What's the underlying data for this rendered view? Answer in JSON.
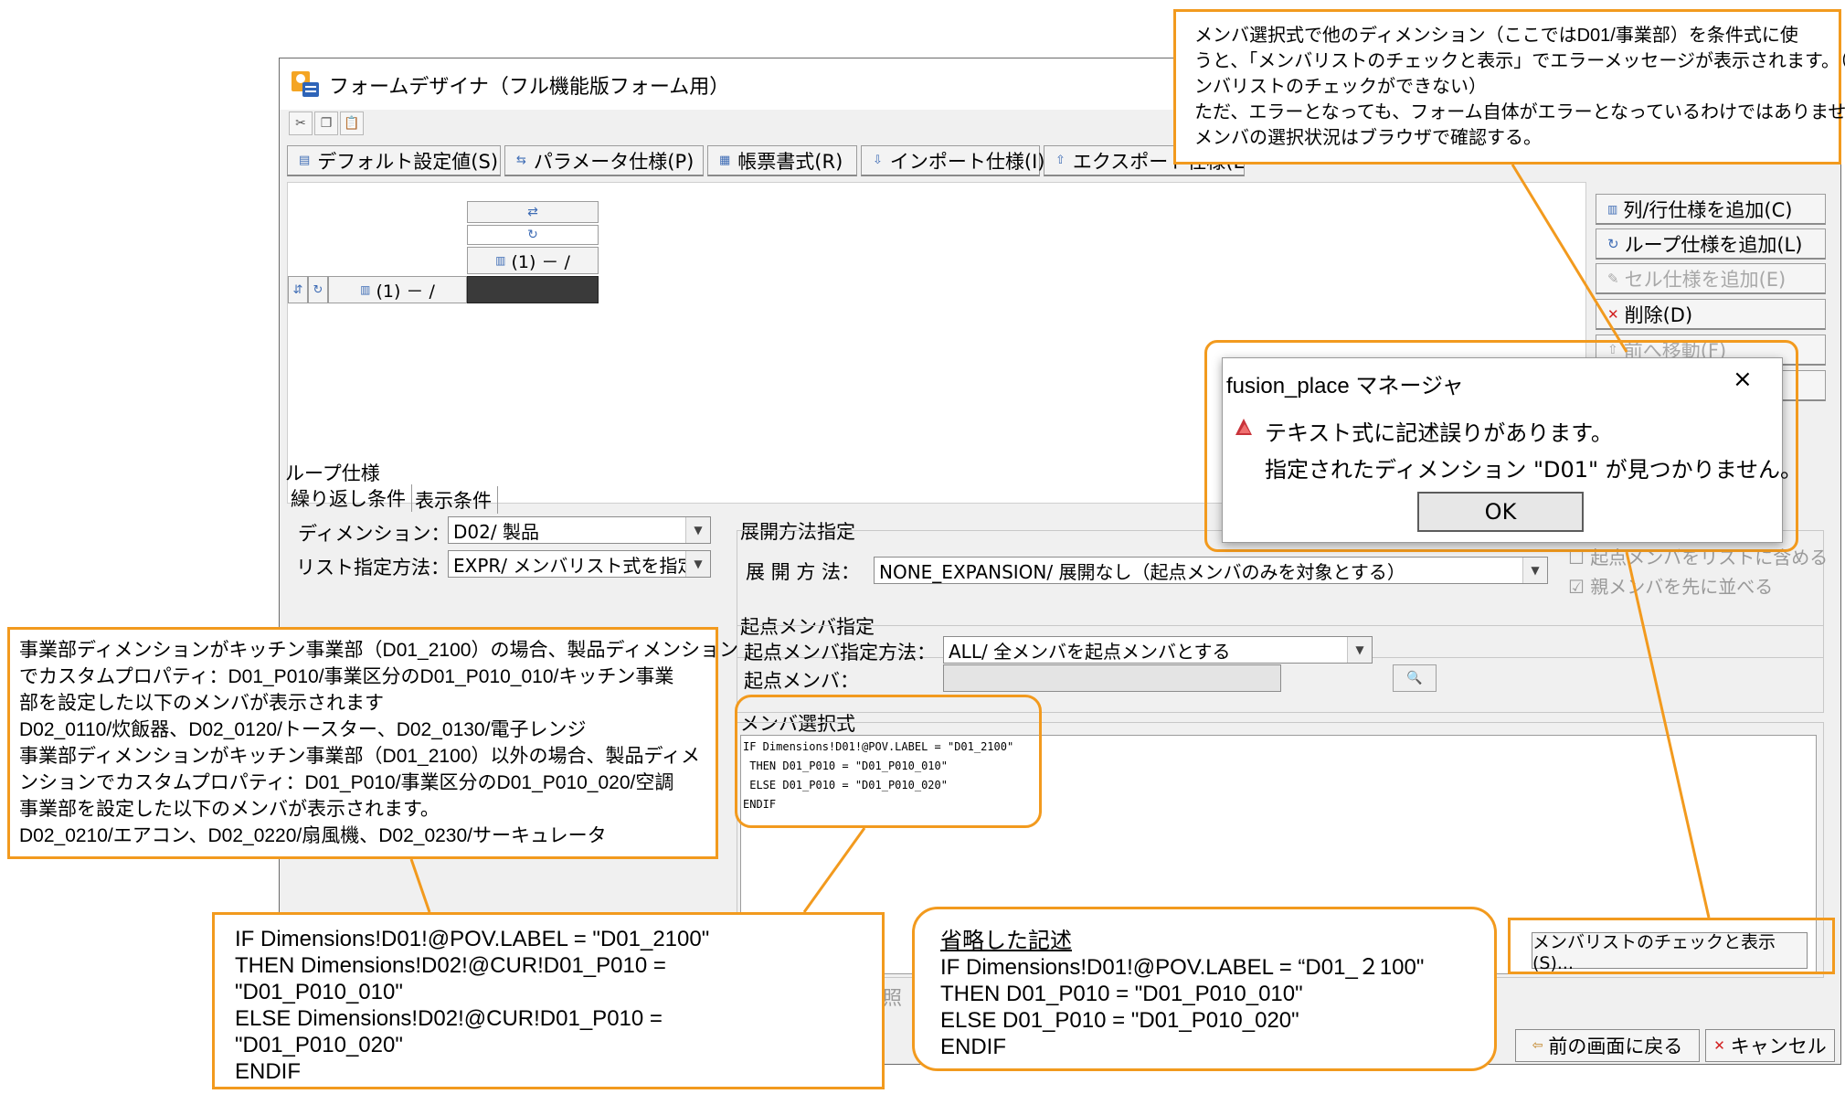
{
  "window": {
    "title": "フォームデザイナ（フル機能版フォーム用）",
    "toolbar_icons": [
      "scissors-icon",
      "copy-icon",
      "paste-icon"
    ],
    "tabs": [
      {
        "label": "デフォルト設定値(S)",
        "icon": "default-icon"
      },
      {
        "label": "パラメータ仕様(P)",
        "icon": "parameter-icon"
      },
      {
        "label": "帳票書式(R)",
        "icon": "report-icon"
      },
      {
        "label": "インポート仕様(I)",
        "icon": "import-icon"
      },
      {
        "label": "エクスポート仕様(E)",
        "icon": "export-icon"
      }
    ],
    "grid": {
      "top_cell_label": "(1) － /",
      "row_cell_label": "(1) － /"
    },
    "side_buttons": [
      {
        "label": "列/行仕様を追加(C)",
        "icon": "grid-icon",
        "enabled": true
      },
      {
        "label": "ループ仕様を追加(L)",
        "icon": "loop-icon",
        "enabled": true
      },
      {
        "label": "セル仕様を追加(E)",
        "icon": "pencil-icon",
        "enabled": false
      },
      {
        "label": "削除(D)",
        "icon": "delete-x-icon",
        "enabled": true
      },
      {
        "label": "前へ移動(F)",
        "icon": "up-arrow-icon",
        "enabled": false
      }
    ],
    "loop_spec": {
      "section_title": "ループ仕様",
      "tabs": [
        "繰り返し条件",
        "表示条件"
      ],
      "dimension_label": "ディメンション：",
      "dimension_value": "D02/ 製品",
      "list_method_label": "リスト指定方法：",
      "list_method_value": "EXPR/ メンバリスト式を指定",
      "expansion_group": "展開方法指定",
      "expansion_label": "展 開 方 法：",
      "expansion_value": "NONE_EXPANSION/ 展開なし（起点メンバのみを対象とする）",
      "checkbox_include": "起点メンバをリストに含める",
      "checkbox_parent_first": "親メンバを先に並べる",
      "origin_group": "起点メンバ指定",
      "origin_method_label": "起点メンバ指定方法：",
      "origin_method_value": "ALL/ 全メンバを起点メンバとする",
      "origin_member_label": "起点メンバ：",
      "origin_member_value": "",
      "member_expr_label": "メンバ選択式",
      "member_expr_lines": [
        "IF Dimensions!D01!@POV.LABEL = \"D01_2100\"",
        " THEN D01_P010 = \"D01_P010_010\"",
        " ELSE D01_P010 = \"D01_P010_020\"",
        "ENDIF"
      ],
      "check_button": "メンバリストのチェックと表示(S)...",
      "partial_text": "照"
    },
    "bottom_buttons": {
      "back": "前の画面に戻る",
      "cancel": "キャンセル"
    }
  },
  "dialog": {
    "title": "fusion_place マネージャ",
    "close_glyph": "×",
    "message_line1": "テキスト式に記述誤りがあります。",
    "message_line2": "指定されたディメンション \"D01\" が見つかりません。",
    "ok": "OK"
  },
  "callouts": {
    "top_right": [
      "メンバ選択式で他のディメンション（ここではD01/事業部）を条件式に使",
      "うと、「メンバリストのチェックと表示」でエラーメッセージが表示されます。（メ",
      "ンバリストのチェックができない）",
      "ただ、エラーとなっても、フォーム自体がエラーとなっているわけではありません。",
      "メンバの選択状況はブラウザで確認する。"
    ],
    "left": [
      "事業部ディメンションがキッチン事業部（D01_2100）の場合、製品ディメンション",
      "でカスタムプロパティ：D01_P010/事業区分のD01_P010_010/キッチン事業",
      "部を設定した以下のメンバが表示されます",
      "D02_0110/炊飯器、D02_0120/トースター、D02_0130/電子レンジ",
      "事業部ディメンションがキッチン事業部（D01_2100）以外の場合、製品ディメ",
      "ンションでカスタムプロパティ：D01_P010/事業区分のD01_P010_020/空調",
      "事業部を設定した以下のメンバが表示されます。",
      "D02_0210/エアコン、D02_0220/扇風機、D02_0230/サーキュレータ"
    ],
    "full_expression": [
      "IF Dimensions!D01!@POV.LABEL = \"D01_2100\"",
      " THEN Dimensions!D02!@CUR!D01_P010 =",
      "\"D01_P010_010\"",
      " ELSE Dimensions!D02!@CUR!D01_P010 =",
      "\"D01_P010_020\"",
      "ENDIF"
    ],
    "abbreviated": [
      "省略した記述",
      "IF Dimensions!D01!@POV.LABEL = “D01_２100\"",
      " THEN D01_P010 = \"D01_P010_010\"",
      " ELSE D01_P010 = \"D01_P010_020\"",
      "ENDIF"
    ]
  },
  "colors": {
    "callout_border": "#f29a1e",
    "window_bg": "#f0f0f0",
    "delete_red": "#d22020",
    "accent_blue": "#3e6cb5"
  }
}
